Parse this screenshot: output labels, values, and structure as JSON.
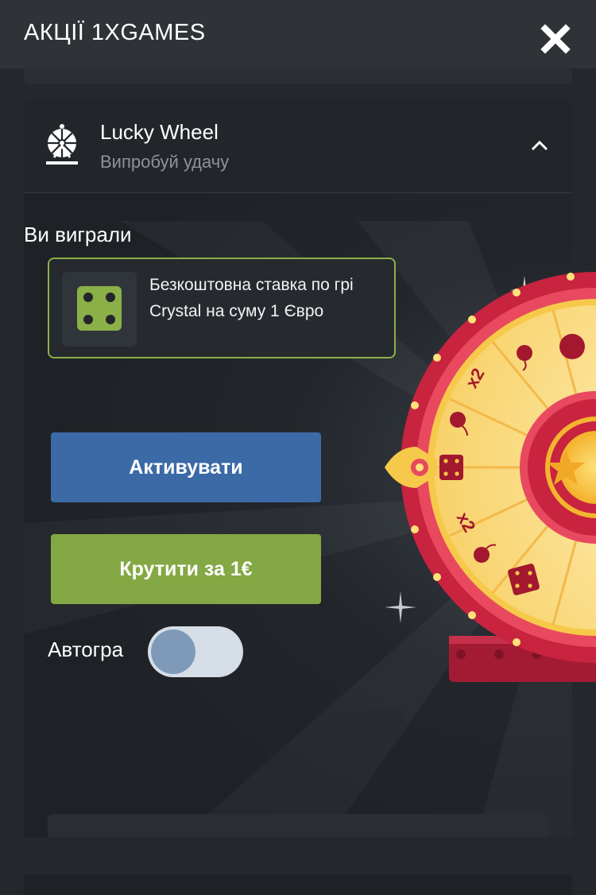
{
  "header": {
    "title": "АКЦІЇ 1XGAMES",
    "close_icon": "close-icon"
  },
  "promo": {
    "name": "Lucky Wheel",
    "subtitle": "Випробуй удачу",
    "icon": "ferris-wheel-icon",
    "expanded": true
  },
  "result": {
    "label": "Ви виграли",
    "prize_text": "Безкоштовна ставка по грі Crystal на суму 1 Євро",
    "prize_icon": "dice-icon"
  },
  "buttons": {
    "activate_label": "Активувати",
    "spin_label": "Крутити за 1€"
  },
  "autoplay": {
    "label": "Автогра",
    "enabled": false
  },
  "colors": {
    "accent_green": "#8bb047",
    "button_blue": "#3b6aa7",
    "button_green": "#84a843",
    "wheel_red": "#c8233f",
    "wheel_gold": "#f6c94a"
  }
}
